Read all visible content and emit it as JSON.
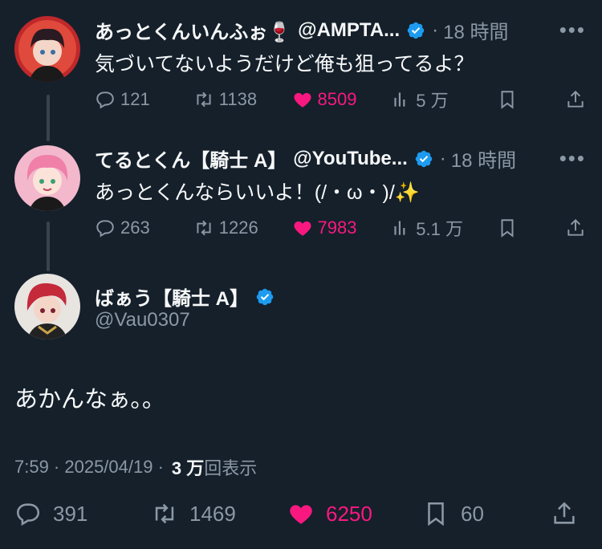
{
  "colors": {
    "background": "#15202b",
    "text": "#f7f9f9",
    "muted": "#8b98a5",
    "like": "#f91880",
    "verified": "#1d9bf0"
  },
  "replies": [
    {
      "name": "あっとくんいんふぉ🍷",
      "handle": "@AMPTA...",
      "time": "18 時間",
      "text": "気づいてないようだけど俺も狙ってるよ？",
      "reply_count": "121",
      "retweet_count": "1138",
      "like_count": "8509",
      "view_count": "5 万"
    },
    {
      "name": "てるとくん【騎士 A】",
      "handle": "@YouTube...",
      "time": "18 時間",
      "text": "あっとくんならいいよ！(/・ω・)/✨",
      "reply_count": "263",
      "retweet_count": "1226",
      "like_count": "7983",
      "view_count": "5.1 万"
    }
  ],
  "main": {
    "name": "ばぁう【騎士 A】",
    "handle": "@Vau0307",
    "text": "あかんなぁ。。",
    "timestamp": "7:59 · 2025/04/19 ·",
    "views_value": "3 万",
    "views_label": "回表示",
    "reply_count": "391",
    "retweet_count": "1469",
    "like_count": "6250",
    "bookmark_count": "60"
  },
  "icons": {
    "verified": "verified-badge-icon",
    "more": "more-icon",
    "reply": "reply-icon",
    "retweet": "retweet-icon",
    "like": "heart-icon",
    "views": "views-icon",
    "bookmark": "bookmark-icon",
    "share": "share-icon"
  },
  "more_glyph": "•••"
}
